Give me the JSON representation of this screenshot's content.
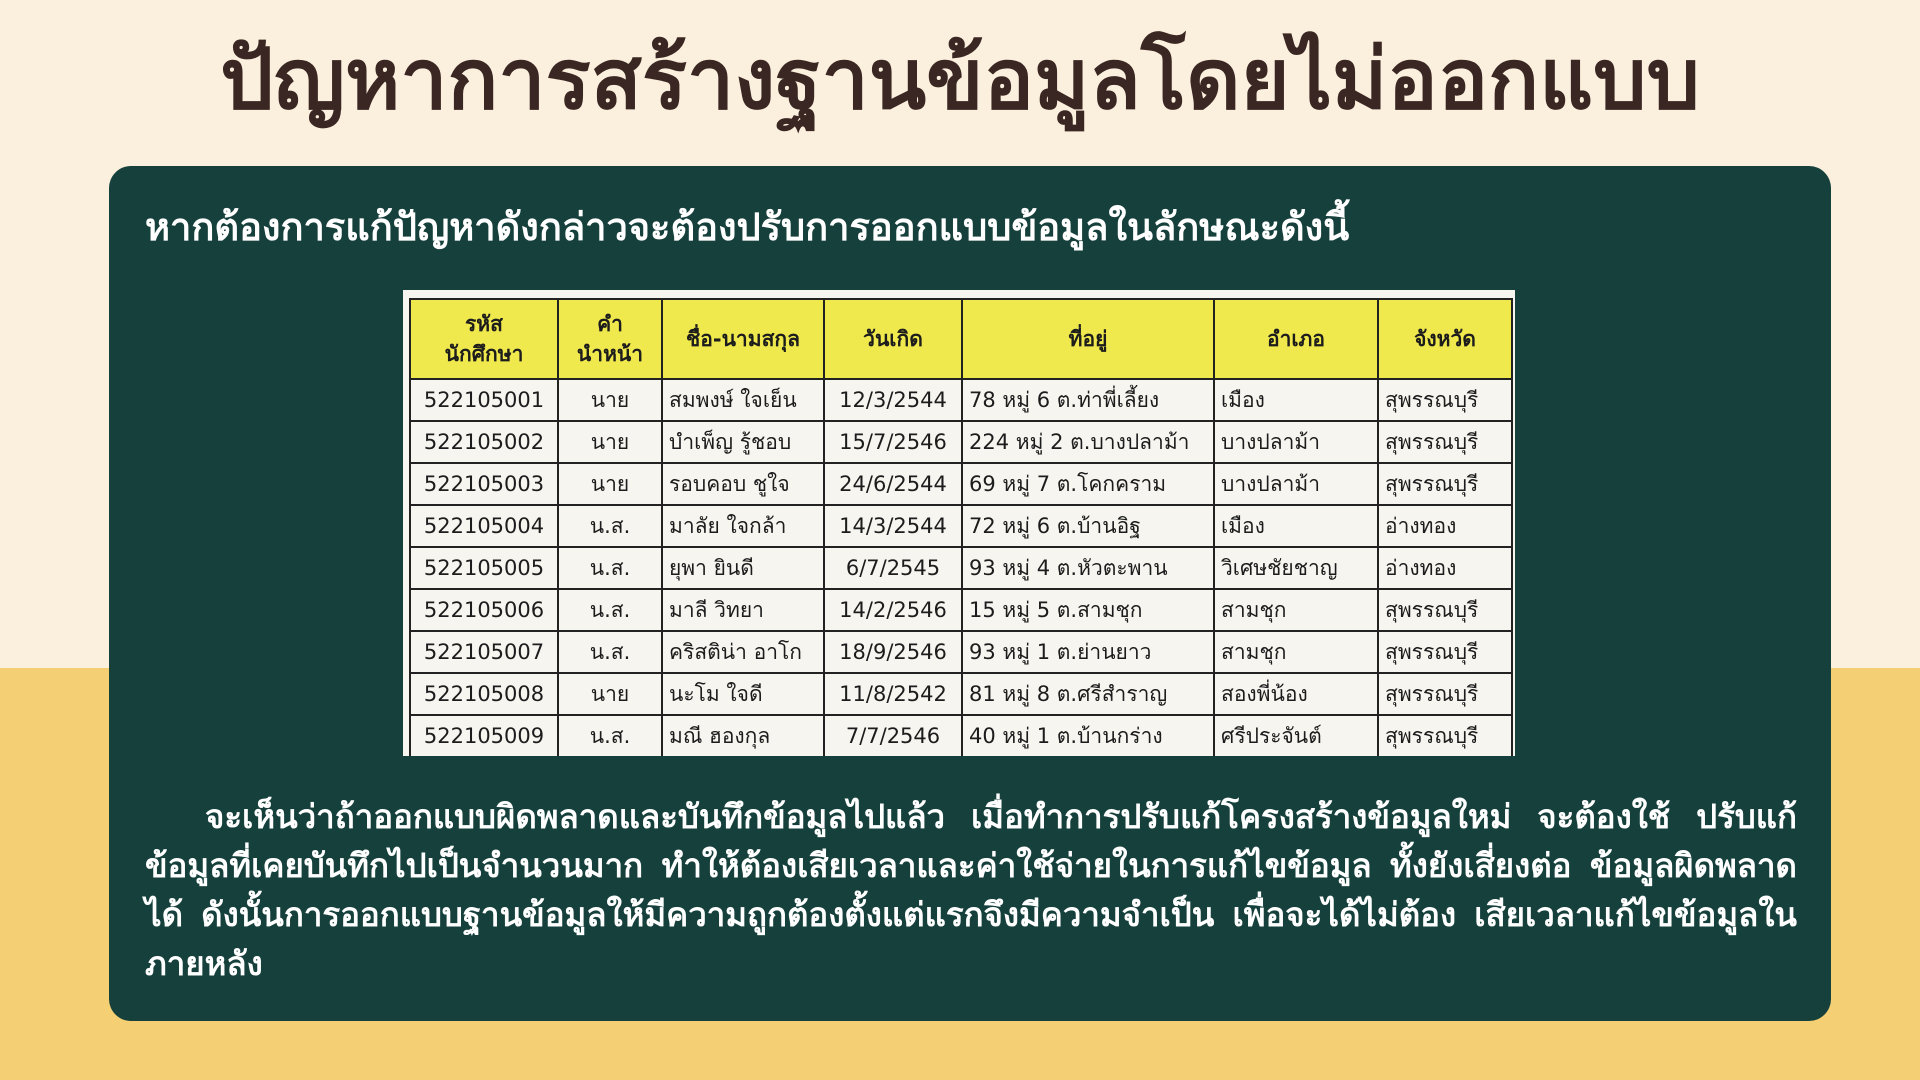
{
  "title": "ปัญหาการสร้างฐานข้อมูลโดยไม่ออกแบบ",
  "subtitle": "หากต้องการแก้ปัญหาดังกล่าวจะต้องปรับการออกแบบข้อมูลในลักษณะดังนี้",
  "table": {
    "headers": {
      "id_line1": "รหัส",
      "id_line2": "นักศึกษา",
      "prefix_line1": "คำ",
      "prefix_line2": "นำหน้า",
      "name": "ชื่อ-นามสกุล",
      "dob": "วันเกิด",
      "address": "ที่อยู่",
      "district": "อำเภอ",
      "province": "จังหวัด"
    },
    "rows": [
      [
        "522105001",
        "นาย",
        "สมพงษ์ ใจเย็น",
        "12/3/2544",
        "78 หมู่ 6 ต.ท่าพี่เลี้ยง",
        "เมือง",
        "สุพรรณบุรี"
      ],
      [
        "522105002",
        "นาย",
        "บำเพ็ญ รู้ชอบ",
        "15/7/2546",
        "224 หมู่ 2 ต.บางปลาม้า",
        "บางปลาม้า",
        "สุพรรณบุรี"
      ],
      [
        "522105003",
        "นาย",
        "รอบคอบ ชูใจ",
        "24/6/2544",
        "69 หมู่ 7 ต.โคกคราม",
        "บางปลาม้า",
        "สุพรรณบุรี"
      ],
      [
        "522105004",
        "น.ส.",
        "มาลัย ใจกล้า",
        "14/3/2544",
        "72 หมู่ 6 ต.บ้านอิฐ",
        "เมือง",
        "อ่างทอง"
      ],
      [
        "522105005",
        "น.ส.",
        "ยุพา ยินดี",
        "6/7/2545",
        "93 หมู่ 4 ต.หัวตะพาน",
        "วิเศษชัยชาญ",
        "อ่างทอง"
      ],
      [
        "522105006",
        "น.ส.",
        "มาลี วิทยา",
        "14/2/2546",
        "15 หมู่ 5 ต.สามชุก",
        "สามชุก",
        "สุพรรณบุรี"
      ],
      [
        "522105007",
        "น.ส.",
        "คริสติน่า อาโก",
        "18/9/2546",
        "93 หมู่ 1 ต.ย่านยาว",
        "สามชุก",
        "สุพรรณบุรี"
      ],
      [
        "522105008",
        "นาย",
        "นะโม ใจดี",
        "11/8/2542",
        "81 หมู่ 8 ต.ศรีสำราญ",
        "สองพี่น้อง",
        "สุพรรณบุรี"
      ],
      [
        "522105009",
        "น.ส.",
        "มณี ฮองกุล",
        "7/7/2546",
        "40 หมู่ 1 ต.บ้านกร่าง",
        "ศรีประจันต์",
        "สุพรรณบุรี"
      ]
    ]
  },
  "paragraph": "จะเห็นว่าถ้าออกแบบผิดพลาดและบันทึกข้อมูลไปแล้ว เมื่อทำการปรับแก้โครงสร้างข้อมูลใหม่ จะต้องใช้ ปรับแก้ข้อมูลที่เคยบันทึกไปเป็นจำนวนมาก ทำให้ต้องเสียเวลาและค่าใช้จ่ายในการแก้ไขข้อมูล ทั้งยังเสี่ยงต่อ ข้อมูลผิดพลาดได้ ดังนั้นการออกแบบฐานข้อมูลให้มีความถูกต้องตั้งแต่แรกจึงมีความจำเป็น เพื่อจะได้ไม่ต้อง เสียเวลาแก้ไขข้อมูลในภายหลัง",
  "colors": {
    "background_top": "#fbf0dd",
    "background_bottom": "#f5cf74",
    "panel": "#16403c",
    "title": "#3a2622",
    "table_header": "#f0e94d"
  }
}
